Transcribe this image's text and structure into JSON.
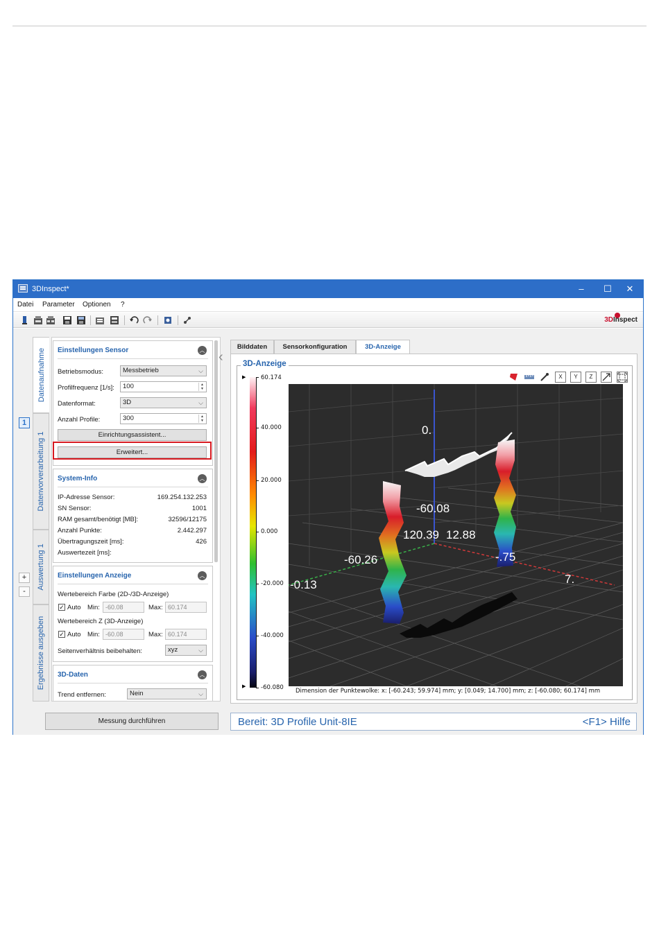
{
  "window": {
    "title": "3DInspect*",
    "brand_prefix": "3D",
    "brand_suffix": "Inspect"
  },
  "menu": [
    "Datei",
    "Parameter",
    "Optionen",
    "?"
  ],
  "toolbar_icons": [
    "sensor-icon",
    "open-icon",
    "open-all-icon",
    "save-icon",
    "save-all-icon",
    "load-config-icon",
    "save-config-icon",
    "undo-icon",
    "redo-icon",
    "settings-icon",
    "network-icon"
  ],
  "vertical_tabs": [
    "Datenaufnahme",
    "Datenvorverarbeitung 1",
    "Auswertung 1",
    "Ergebnisse ausgeben"
  ],
  "step_badge": "1",
  "side_buttons": [
    "+",
    "-"
  ],
  "sensor_settings": {
    "title": "Einstellungen Sensor",
    "betriebsmodus_label": "Betriebsmodus:",
    "betriebsmodus_value": "Messbetrieb",
    "profilfrequenz_label": "Profilfrequenz [1/s]:",
    "profilfrequenz_value": "100",
    "datenformat_label": "Datenformat:",
    "datenformat_value": "3D",
    "anzahl_profile_label": "Anzahl Profile:",
    "anzahl_profile_value": "300",
    "wizard_button": "Einrichtungsassistent...",
    "advanced_button": "Erweitert..."
  },
  "system_info": {
    "title": "System-Info",
    "rows": [
      {
        "label": "IP-Adresse Sensor:",
        "value": "169.254.132.253"
      },
      {
        "label": "SN Sensor:",
        "value": "1001"
      },
      {
        "label": "RAM gesamt/benötigt [MB]:",
        "value": "32596/12175"
      },
      {
        "label": "Anzahl Punkte:",
        "value": "2.442.297"
      },
      {
        "label": "Übertragungszeit [ms]:",
        "value": "426"
      },
      {
        "label": "Auswertezeit [ms]:",
        "value": ""
      }
    ]
  },
  "display_settings": {
    "title": "Einstellungen Anzeige",
    "color_range_label": "Wertebereich Farbe (2D-/3D-Anzeige)",
    "z_range_label": "Wertebereich Z (3D-Anzeige)",
    "auto_label": "Auto",
    "min_label": "Min:",
    "max_label": "Max:",
    "color_min": "-60.08",
    "color_max": "60.174",
    "z_min": "-60.08",
    "z_max": "60.174",
    "aspect_label": "Seitenverhältnis beibehalten:",
    "aspect_value": "xyz"
  },
  "data_3d": {
    "title": "3D-Daten",
    "trend_label": "Trend entfernen:",
    "trend_value": "Nein"
  },
  "measure_button": "Messung durchführen",
  "status": {
    "left": "Bereit: 3D Profile Unit-8IE",
    "right": "<F1> Hilfe"
  },
  "right_tabs": [
    "Bilddaten",
    "Sensorkonfiguration",
    "3D-Anzeige"
  ],
  "view3d": {
    "title": "3D-Anzeige",
    "colorbar_labels": [
      "60.174",
      "40.000",
      "20.000",
      "0.000",
      "-20.000",
      "-40.000",
      "-60.080"
    ],
    "axis_labels": [
      "0.",
      "-60.08",
      "120.39",
      "12.88",
      "-60.26",
      "-0.13",
      "-.75",
      "7."
    ],
    "dimension_text": "Dimension der Punktewolke:   x: [-60.243; 59.974] mm;   y: [0.049; 14.700] mm;   z: [-60.080; 60.174] mm",
    "view_tool_icons": [
      "color-icon",
      "ruler-icon",
      "pipette-icon",
      "x-axis-icon",
      "y-axis-icon",
      "z-axis-icon",
      "iso-view-icon",
      "fit-view-icon"
    ],
    "view_tool_glyphs": [
      "",
      "",
      "",
      "X",
      "Y",
      "Z",
      "",
      ""
    ]
  }
}
